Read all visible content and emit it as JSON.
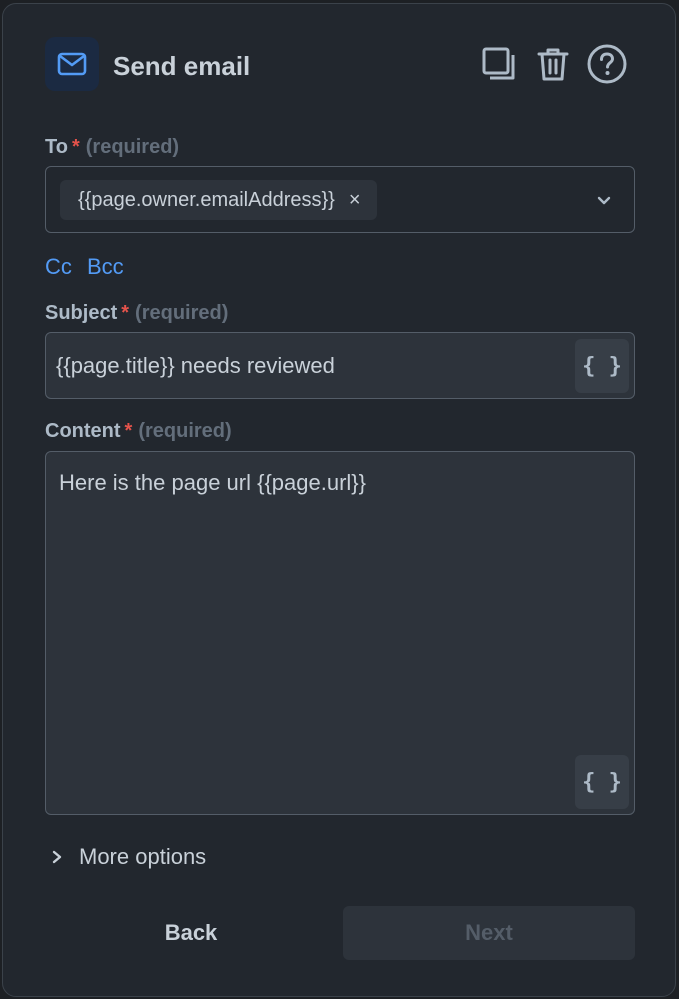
{
  "header": {
    "icon": "mail-icon",
    "title": "Send email",
    "actions": [
      {
        "icon": "duplicate-icon"
      },
      {
        "icon": "trash-icon"
      },
      {
        "icon": "help-circle-icon"
      }
    ]
  },
  "to": {
    "label": "To",
    "required_star": "*",
    "required_text": "(required)",
    "chips": [
      {
        "value": "{{page.owner.emailAddress}}",
        "remove_glyph": "×"
      }
    ],
    "dropdown_icon": "chevron-down-icon"
  },
  "links": {
    "cc": "Cc",
    "bcc": "Bcc"
  },
  "subject": {
    "label": "Subject",
    "required_star": "*",
    "required_text": "(required)",
    "value": "{{page.title}} needs reviewed",
    "variable_button": "{ }"
  },
  "content": {
    "label": "Content",
    "required_star": "*",
    "required_text": "(required)",
    "value": "Here is the page url {{page.url}}",
    "variable_button": "{ }"
  },
  "more_options": {
    "label": "More options",
    "icon": "chevron-right-icon"
  },
  "footer": {
    "back_label": "Back",
    "next_label": "Next"
  },
  "colors": {
    "panel_bg": "#22272e",
    "accent": "#539bf5",
    "required_star": "#e5534b",
    "muted": "#636e7b"
  }
}
